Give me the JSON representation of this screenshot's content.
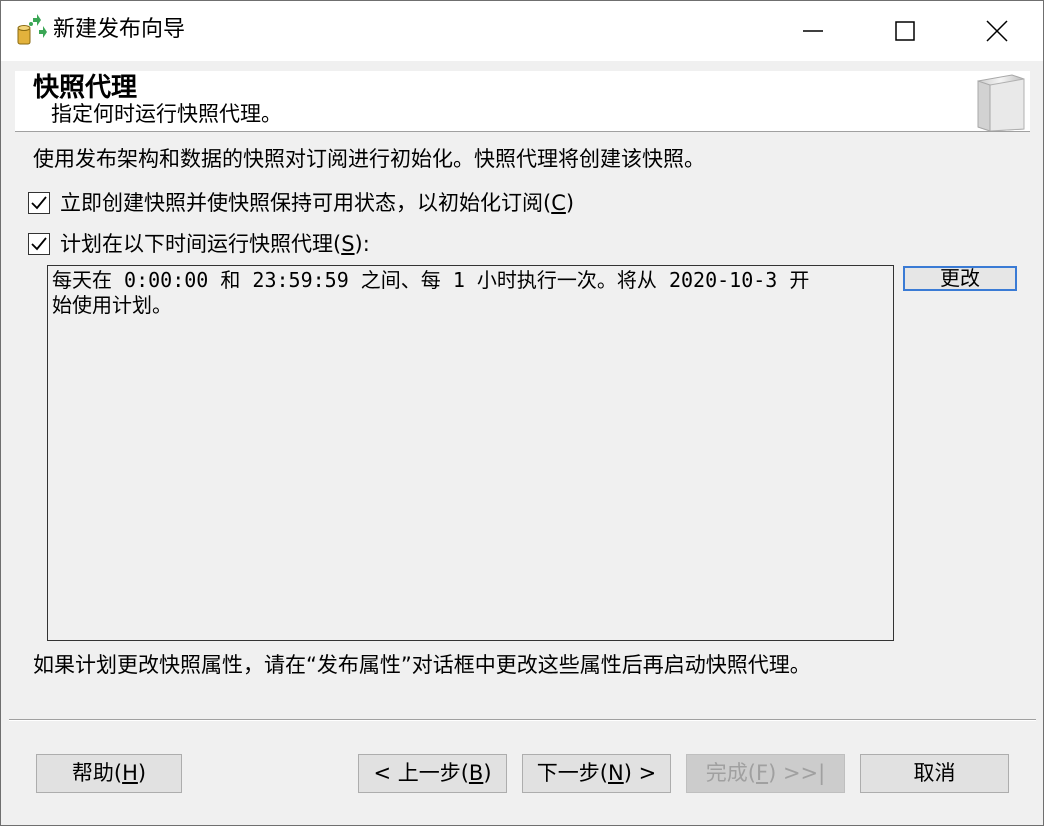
{
  "window": {
    "title": "新建发布向导",
    "app_icon": "publication-wizard-icon",
    "controls": [
      "minimize-icon",
      "maximize-icon",
      "close-icon"
    ]
  },
  "header": {
    "title": "快照代理",
    "subtitle": "指定何时运行快照代理。",
    "decoration_icon": "book-icon"
  },
  "description": "使用发布架构和数据的快照对订阅进行初始化。快照代理将创建该快照。",
  "options": [
    {
      "text": "立即创建快照并使快照保持可用状态，以初始化订阅(",
      "mnemonic": "C",
      "suffix": ")",
      "checked": true
    },
    {
      "text": "计划在以下时间运行快照代理(",
      "mnemonic": "S",
      "suffix": "):",
      "checked": true
    }
  ],
  "schedule": {
    "text": "每天在 0:00:00 和 23:59:59 之间、每 1 小时执行一次。将从 2020-10-3 开\n始使用计划。",
    "change_label": "更改"
  },
  "note": "如果计划更改快照属性，请在“发布属性”对话框中更改这些属性后再启动快照代理。",
  "buttons": {
    "help": {
      "text": "帮助(",
      "mnemonic": "H",
      "suffix": ")"
    },
    "back": {
      "prefix": "< 上一步(",
      "mnemonic": "B",
      "suffix": ")"
    },
    "next": {
      "prefix": "下一步(",
      "mnemonic": "N",
      "suffix": ") >"
    },
    "finish": {
      "prefix": "完成(",
      "mnemonic": "F",
      "suffix": ") >>|",
      "disabled": true
    },
    "cancel": "取消"
  },
  "colors": {
    "background": "#f0f0f0",
    "focus_border": "#3a7bd5",
    "disabled_text": "#a0a0a0"
  }
}
